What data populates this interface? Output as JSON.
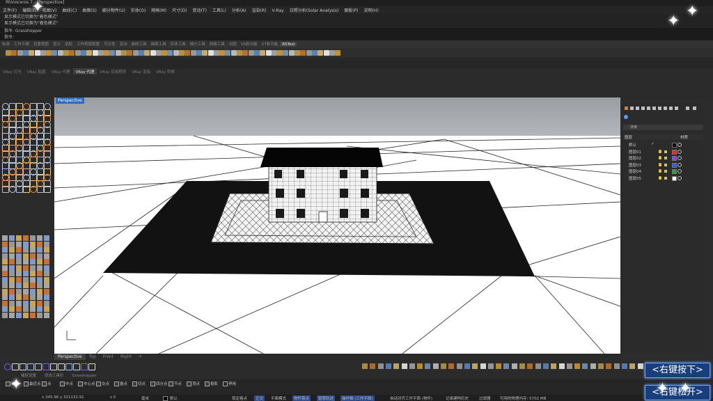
{
  "window": {
    "title": "Rhinoceros 7 - [Perspective]"
  },
  "menu": [
    "文件(F)",
    "编辑(E)",
    "视图(V)",
    "曲线(C)",
    "曲面(S)",
    "细分物件(U)",
    "实体(O)",
    "网格(M)",
    "尺寸(D)",
    "变动(T)",
    "工具(L)",
    "分析(A)",
    "渲染(R)",
    "V-Ray",
    "日照分析(Solar Analysis)",
    "面板(P)",
    "说明(H)"
  ],
  "command_history": [
    "显示模式已切换为\"着色模式\"",
    "显示模式已切换为\"着色模式\""
  ],
  "command_line": [
    "指令: Grasshopper",
    "指令:"
  ],
  "toolbar_tabs": [
    "标准",
    "工作平面",
    "设置视图",
    "显示",
    "选取",
    "工作视窗配置",
    "可见性",
    "变动",
    "曲线工具",
    "曲面工具",
    "实体工具",
    "细分工具",
    "网格工具",
    "出图",
    "V6新功能",
    "V7新功能",
    "RSTool"
  ],
  "toolbar_active_tab": "RSTool",
  "vray_tabs": [
    "VRay 灯光",
    "VRay 贴图",
    "VRay 代理",
    "VRay 代理",
    "VRay 实用程序",
    "VRay 渲染",
    "VRay 转换"
  ],
  "vray_active_index": 3,
  "viewport": {
    "title": "Perspective",
    "tabs": [
      "Perspective",
      "Top",
      "Front",
      "Right"
    ],
    "active_tab": "Perspective",
    "add_tab_icon": "+"
  },
  "layers": {
    "search_placeholder": "搜索",
    "header": {
      "name": "图层",
      "material": "材质"
    },
    "rows": [
      {
        "name": "默认",
        "color": "#000000",
        "current": true
      },
      {
        "name": "图层01",
        "color": "#ff2020"
      },
      {
        "name": "图层02",
        "color": "#8a3cff"
      },
      {
        "name": "图层03",
        "color": "#2d5bff"
      },
      {
        "name": "图层04",
        "color": "#22aa22"
      },
      {
        "name": "图层05",
        "color": "#ffffff"
      }
    ]
  },
  "bottom_tabs": [
    "捕捉设置",
    "状态工具栏",
    "Grasshopper"
  ],
  "snaps": [
    "端点",
    "最近点",
    "点",
    "中点",
    "中心点",
    "交点",
    "垂点",
    "切点",
    "四分点",
    "节点",
    "顶点",
    "投影",
    "停用"
  ],
  "status": {
    "coords": "x 345.96  y 321132.91",
    "z": "z 0",
    "units": "毫米",
    "layer": "默认",
    "buttons": [
      "锁定格点",
      "正交",
      "平面模式",
      "物件锁点",
      "智慧轨迹",
      "操作轴 (工作平面)"
    ],
    "auto_cplane": "自动对齐工作平面 (物件)",
    "history": "记录建构历史",
    "filter": "过滤器",
    "memory": "可用的物理内存: 5702 MB"
  },
  "overlay": {
    "top": "<右键按下>",
    "bottom": "<右键松开>"
  },
  "colors": {
    "accent": "#2d6cc0",
    "background": "#2c2c2c"
  }
}
